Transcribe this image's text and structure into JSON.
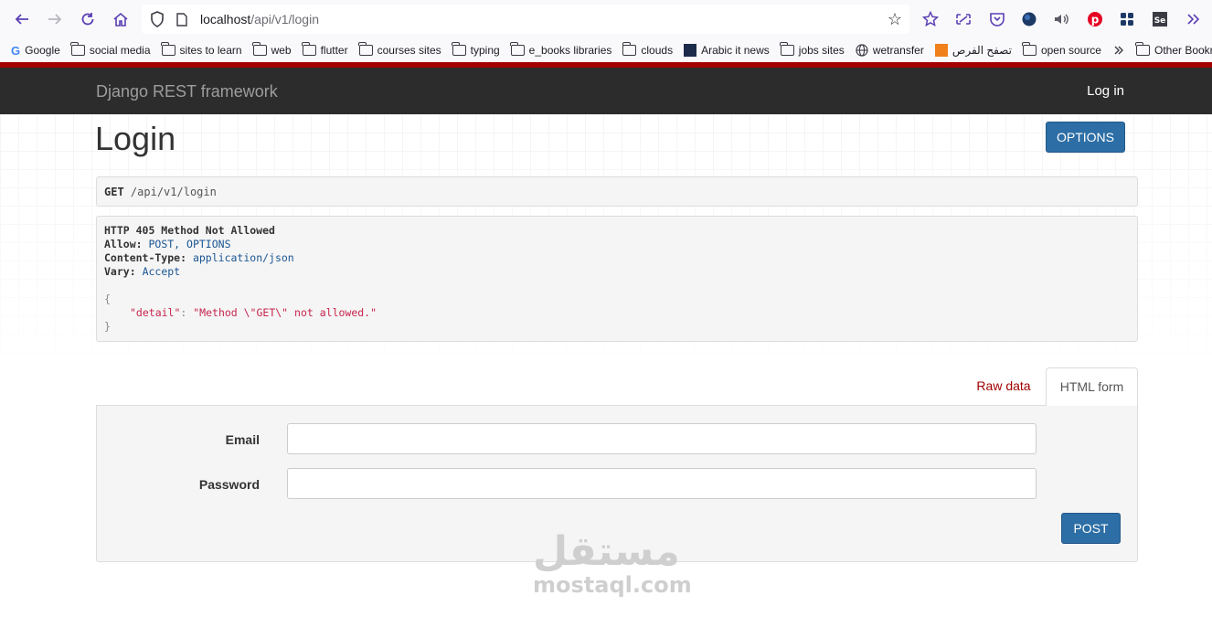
{
  "browser": {
    "url_host": "localhost",
    "url_path": "/api/v1/login",
    "bookmarks": [
      {
        "label": "Google",
        "icon": "google-icon"
      },
      {
        "label": "social media",
        "icon": "folder-icon"
      },
      {
        "label": "sites to learn",
        "icon": "folder-icon"
      },
      {
        "label": "web",
        "icon": "folder-icon"
      },
      {
        "label": "flutter",
        "icon": "folder-icon"
      },
      {
        "label": "courses sites",
        "icon": "folder-icon"
      },
      {
        "label": "typing",
        "icon": "folder-icon"
      },
      {
        "label": "e_books libraries",
        "icon": "folder-icon"
      },
      {
        "label": "clouds",
        "icon": "folder-icon"
      },
      {
        "label": "Arabic it news",
        "icon": "site-icon"
      },
      {
        "label": "jobs sites",
        "icon": "folder-icon"
      },
      {
        "label": "wetransfer",
        "icon": "globe-icon"
      },
      {
        "label": "تصفح الفرص",
        "icon": "site-icon"
      },
      {
        "label": "open source",
        "icon": "folder-icon"
      }
    ],
    "other_bookmarks": "Other Bookm"
  },
  "navbar": {
    "brand": "Django REST framework",
    "login": "Log in"
  },
  "page": {
    "title": "Login",
    "options_label": "OPTIONS",
    "request": {
      "method": "GET",
      "path": "/api/v1/login"
    },
    "response": {
      "status_line": "HTTP 405 Method Not Allowed",
      "headers": [
        {
          "name": "Allow:",
          "value": "POST, OPTIONS"
        },
        {
          "name": "Content-Type:",
          "value": "application/json"
        },
        {
          "name": "Vary:",
          "value": "Accept"
        }
      ],
      "open_brace": "{",
      "body_key": "\"detail\"",
      "body_value": "\"Method \\\"GET\\\" not allowed.\"",
      "close_brace": "}"
    },
    "tabs": {
      "raw": "Raw data",
      "html": "HTML form"
    },
    "form": {
      "email_label": "Email",
      "password_label": "Password",
      "email_value": "",
      "password_value": "",
      "submit_label": "POST"
    }
  },
  "watermark": {
    "arabic": "مستقل",
    "latin": "mostaql.com"
  },
  "colors": {
    "navbar": "#2c2c2c",
    "primary_button": "#2c6ea5",
    "active_tab_text": "#a00000",
    "accent_bar": "#a30000"
  }
}
